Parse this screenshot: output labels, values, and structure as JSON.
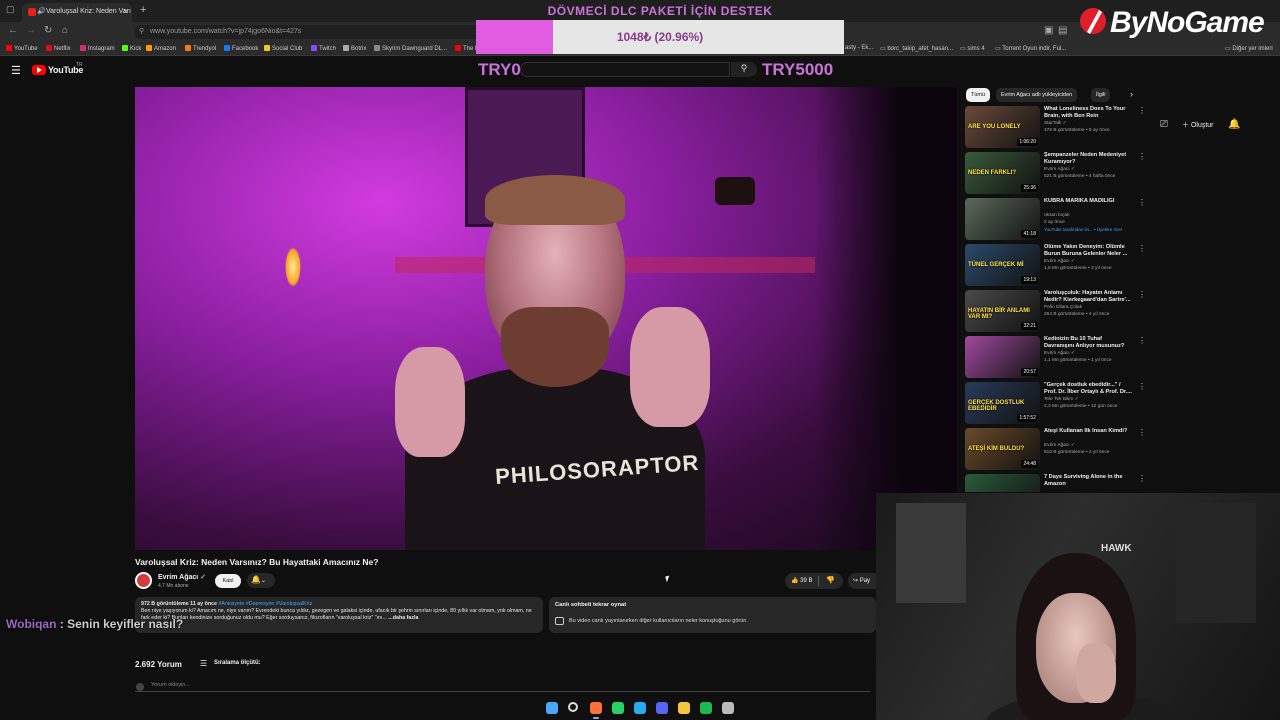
{
  "browser": {
    "tab_title": "Varoluşsal Kriz: Neden Varı",
    "url": "www.youtube.com/watch?v=jp74jgo6Nio&t=427s",
    "bookmarks": [
      {
        "label": "YouTube",
        "color": "#ff0000"
      },
      {
        "label": "Netflix",
        "color": "#e50914"
      },
      {
        "label": "Instagram",
        "color": "#d62976"
      },
      {
        "label": "Kick",
        "color": "#53fc18"
      },
      {
        "label": "Amazon",
        "color": "#ff9900"
      },
      {
        "label": "Trendyol",
        "color": "#f27a1a"
      },
      {
        "label": "Facebook",
        "color": "#1877f2"
      },
      {
        "label": "Social Club",
        "color": "#f5c518"
      },
      {
        "label": "Twitch",
        "color": "#9146ff"
      },
      {
        "label": "Botrix",
        "color": "#aaaaaa"
      },
      {
        "label": "Skyrim Dawnguard DL...",
        "color": "#888888"
      },
      {
        "label": "The B",
        "color": "#ff0000"
      }
    ],
    "bookmarks_right": [
      {
        "label": "asty - Ek..."
      },
      {
        "label": "borc_takip_afet_hasan..."
      },
      {
        "label": "sims 4"
      },
      {
        "label": "Torrent Oyun indir, Ful..."
      },
      {
        "label": "Diğer yer imleri"
      }
    ]
  },
  "overlay": {
    "donation_title": "DÖVMECİ DLC PAKETİ İÇİN DESTEK",
    "progress_text": "1048₺ (20.96%)",
    "progress_fraction": 0.2096,
    "goal_min": "TRY0",
    "goal_max": "TRY5000",
    "brand_logo": "ByNoGame",
    "chat_user": "Wobiqan",
    "chat_text": "Senin keyifler nasıl?",
    "accent": "#c874d8",
    "fill_color": "#e05ce0"
  },
  "youtube": {
    "logo_text": "YouTube",
    "country_code": "TR",
    "create_label": "Oluştur",
    "video": {
      "title": "Varoluşsal Kriz: Neden Varsınız? Bu Hayattaki Amacınız Ne?",
      "shirt_text": "PHILOSORAPTOR"
    },
    "channel": {
      "name": "Evrim Ağacı",
      "subscribers": "4,7 Mn abone",
      "join_label": "Katıl"
    },
    "likes": "39 B",
    "share_label": "Pay",
    "description": {
      "meta": "972 B görüntüleme  11 ay önce",
      "tags": "#Anksiyete #Depresyon #VaroluşsalKriz",
      "text": "Ben niye yaşıyorum ki? Amacım ne, niye varım? Evrendeki bunca yıldız, gezegen ve galaksi içinde, ufacık bir şehrin sınırları içinde, 80 yıllık var olmam, yok olmam, ne fark eder ki? Bunları kendinize sorduğunuz oldu mu? Eğer sorduysanız, filozofların \"varoluşsal kriz\" \"ını... ",
      "more": "...daha fazla"
    },
    "live_chat": {
      "title": "Canlı sohbeti tekrar oynat",
      "desc": "Bu video canlı yayınlanırken diğer kullanıcıların neler konuştuğunu görün."
    },
    "comments": {
      "count": "2.692 Yorum",
      "sort_label": "Sıralama ölçütü:",
      "placeholder": "Yorum ekleyin..."
    },
    "chips": [
      "Tümü",
      "Evrim Ağacı adlı yükleyiciden",
      "İlgili"
    ],
    "recommended": [
      {
        "title": "What Loneliness Does To Your Brain, with Ben Rein",
        "channel": "StarTalk ✓",
        "meta": "475 B görüntüleme • 5 ay önce",
        "duration": "1:06:20",
        "thumb": "#6a4a3a",
        "thumb_label": "ARE YOU LONELY"
      },
      {
        "title": "Şempanzeler Neden Medeniyet Kuramıyor?",
        "channel": "Evrim Ağacı ✓",
        "meta": "521 B görüntüleme • 4 hafta önce",
        "duration": "25:36",
        "thumb": "#3a5a3a",
        "thumb_label": "NEDEN FARKLI?"
      },
      {
        "title": "KÜBRA MARİKA MADİLİĞİ",
        "channel": "oksan bıçak",
        "meta": "2 ay önce",
        "badge": "YouTube tarafından lin... • Üyelere özel",
        "duration": "41:18",
        "thumb": "#5a6a5a",
        "thumb_label": ""
      },
      {
        "title": "Ölüme Yakın Deneyim: Ölümle Burun Buruna Gelenler Neler ...",
        "channel": "Evrim Ağacı ✓",
        "meta": "1,6 Mn görüntüleme • 3 yıl önce",
        "duration": "19:13",
        "thumb": "#2a4a6a",
        "thumb_label": "TÜNEL GERÇEK Mİ"
      },
      {
        "title": "Varoluşçuluk: Hayatın Anlamı Nedir? Kierkegaard'dan Sartre'...",
        "channel": "Pelin Dilara Çolak",
        "meta": "264 B görüntüleme • 4 yıl önce",
        "duration": "32:21",
        "thumb": "#4a4a4a",
        "thumb_label": "HAYATIN BİR ANLAMI VAR MI?"
      },
      {
        "title": "Kedinizin Bu 10 Tuhaf Davranışını Anlıyor musunuz?",
        "channel": "Evrim Ağacı ✓",
        "meta": "1,1 Mn görüntüleme • 1 yıl önce",
        "duration": "20:57",
        "thumb": "#a04aa0",
        "thumb_label": ""
      },
      {
        "title": "\"Gerçek dostluk ebedidir...\" / Prof. Dr. İlber Ortaylı & Prof. Dr....",
        "channel": "Tele Tek Bilim ✓",
        "meta": "2,3 Mn görüntüleme • 12 gün önce",
        "duration": "1:57:52",
        "thumb": "#2a3a5a",
        "thumb_label": "GERÇEK DOSTLUK EBEDİDİR"
      },
      {
        "title": "Ateşi Kullanan İlk İnsan Kimdi?",
        "channel": "Evrim Ağacı ✓",
        "meta": "610 B görüntüleme • 2 yıl önce",
        "duration": "24:48",
        "thumb": "#6a4a2a",
        "thumb_label": "ATEŞİ KİM BULDU?"
      },
      {
        "title": "7 Days Surviving Alone in the Amazon",
        "channel": "",
        "meta": "",
        "duration": "",
        "thumb": "#2a5a3a",
        "thumb_label": ""
      }
    ]
  },
  "webcam": {
    "cap_text": "HAWK"
  },
  "taskbar": {
    "icons": [
      {
        "name": "windows-start-icon",
        "color": "#4aa8ff"
      },
      {
        "name": "search-icon",
        "color": "#dddddd"
      },
      {
        "name": "firefox-icon",
        "color": "#ff7139"
      },
      {
        "name": "whatsapp-icon",
        "color": "#25d366"
      },
      {
        "name": "telegram-icon",
        "color": "#2aabee"
      },
      {
        "name": "discord-icon",
        "color": "#5865f2"
      },
      {
        "name": "file-explorer-icon",
        "color": "#f5c542"
      },
      {
        "name": "spotify-icon",
        "color": "#1db954"
      },
      {
        "name": "settings-icon",
        "color": "#bbbbbb"
      }
    ]
  }
}
